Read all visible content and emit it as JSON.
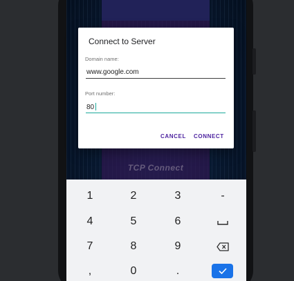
{
  "dialog": {
    "title": "Connect to Server",
    "domain_label": "Domain name:",
    "domain_value": "www.google.com",
    "port_label": "Port number:",
    "port_value": "80",
    "cancel_label": "CANCEL",
    "connect_label": "CONNECT"
  },
  "background": {
    "button_label": "TCP Connect"
  },
  "keyboard": {
    "row1": [
      "1",
      "2",
      "3",
      "-"
    ],
    "row2": [
      "4",
      "5",
      "6"
    ],
    "row3": [
      "7",
      "8",
      "9"
    ],
    "row4": [
      ",",
      "0",
      "."
    ],
    "icons": {
      "space": "space-icon",
      "backspace": "backspace-icon",
      "done": "checkmark-icon"
    }
  },
  "colors": {
    "accent": "#1aa89a",
    "dialog_button": "#4a1f9e",
    "done_button": "#1a73e8"
  }
}
